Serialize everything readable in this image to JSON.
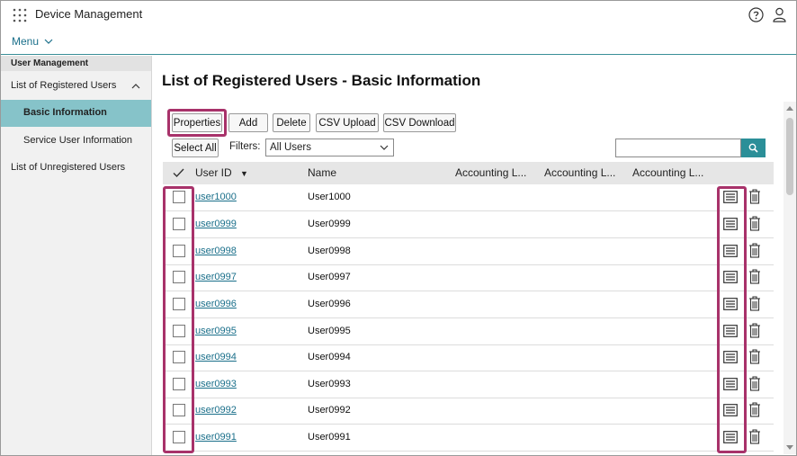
{
  "app": {
    "title": "Device Management"
  },
  "menu": {
    "label": "Menu"
  },
  "sidebar": {
    "section_header": "User Management",
    "items": [
      {
        "label": "List of Registered Users",
        "expanded": true
      },
      {
        "label": "Basic Information",
        "active": true
      },
      {
        "label": "Service User Information"
      },
      {
        "label": "List of Unregistered Users"
      }
    ]
  },
  "main": {
    "title": "List of Registered Users - Basic Information",
    "toolbar": {
      "properties": "Properties",
      "add": "Add",
      "delete": "Delete",
      "csv_upload": "CSV Upload",
      "csv_download": "CSV Download",
      "select_all": "Select All"
    },
    "filters": {
      "label": "Filters:",
      "selected": "All Users"
    },
    "search": {
      "value": ""
    },
    "table": {
      "columns": [
        "User ID",
        "Name",
        "Accounting L...",
        "Accounting L...",
        "Accounting L..."
      ],
      "sort_indicator": "▼",
      "rows": [
        {
          "user_id": "user1000",
          "name": "User1000"
        },
        {
          "user_id": "user0999",
          "name": "User0999"
        },
        {
          "user_id": "user0998",
          "name": "User0998"
        },
        {
          "user_id": "user0997",
          "name": "User0997"
        },
        {
          "user_id": "user0996",
          "name": "User0996"
        },
        {
          "user_id": "user0995",
          "name": "User0995"
        },
        {
          "user_id": "user0994",
          "name": "User0994"
        },
        {
          "user_id": "user0993",
          "name": "User0993"
        },
        {
          "user_id": "user0992",
          "name": "User0992"
        },
        {
          "user_id": "user0991",
          "name": "User0991"
        }
      ]
    }
  },
  "colors": {
    "accent": "#2b8f98",
    "sidebar_active": "#86c3c9",
    "link": "#1a6f8a",
    "highlight": "#a8326a"
  },
  "icons": [
    "apps-grid-icon",
    "help-icon",
    "user-icon",
    "chevron-down-icon",
    "chevron-up-icon",
    "search-icon",
    "detail-icon",
    "trash-icon",
    "checkmark-icon"
  ]
}
